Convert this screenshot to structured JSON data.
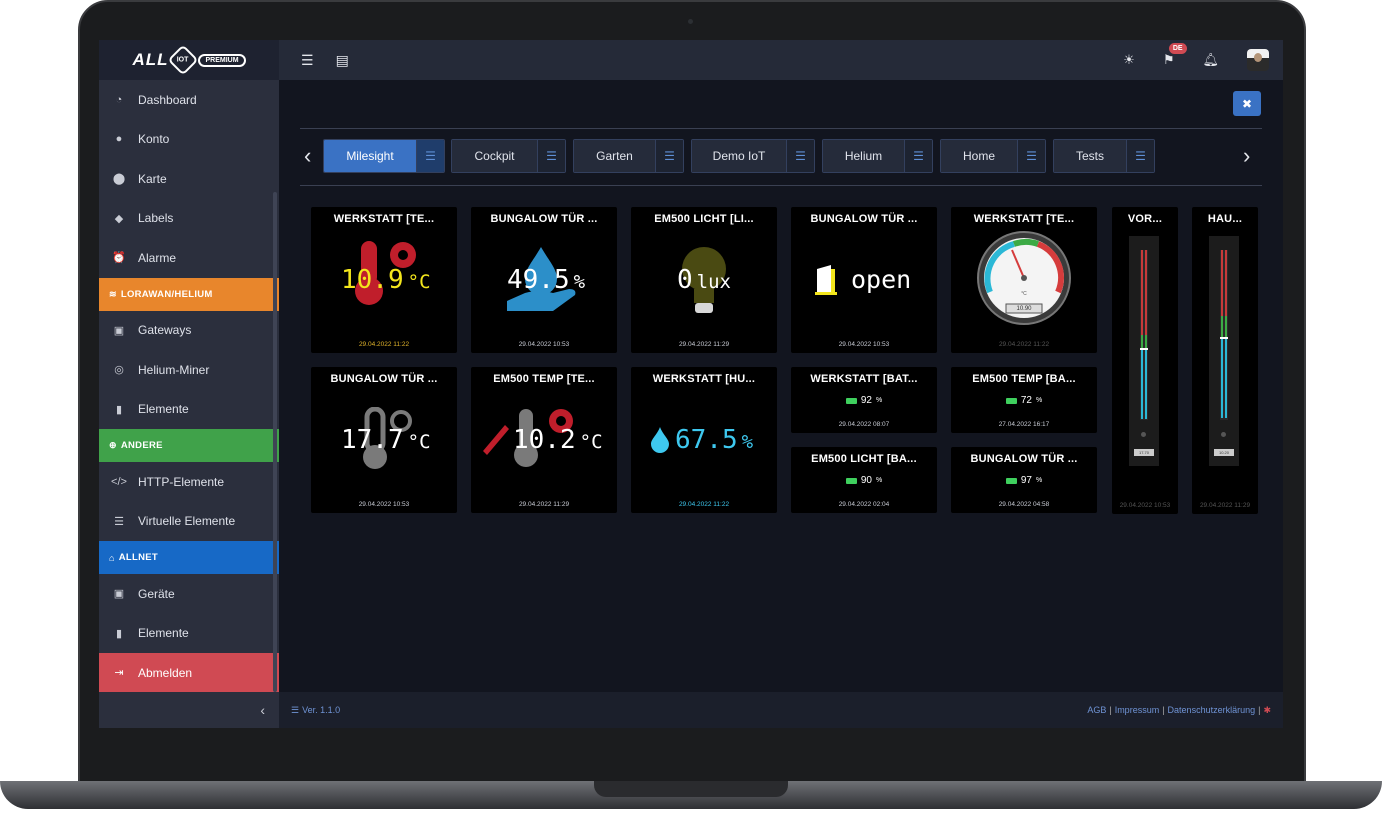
{
  "sidebar": {
    "items": [
      {
        "label": "Dashboard",
        "icon": "gauge-icon"
      },
      {
        "label": "Konto",
        "icon": "user-icon"
      },
      {
        "label": "Karte",
        "icon": "map-pin-icon"
      },
      {
        "label": "Labels",
        "icon": "tag-icon"
      },
      {
        "label": "Alarme",
        "icon": "alarm-clock-icon"
      }
    ],
    "section_lorawan": "LORAWAN/HELIUM",
    "lorawan_items": [
      {
        "label": "Gateways",
        "icon": "chip-icon"
      },
      {
        "label": "Helium-Miner",
        "icon": "miner-icon"
      },
      {
        "label": "Elemente",
        "icon": "thermometer-icon"
      }
    ],
    "section_andere": "ANDERE",
    "andere_items": [
      {
        "label": "HTTP-Elemente",
        "icon": "code-icon"
      },
      {
        "label": "Virtuelle Elemente",
        "icon": "database-icon"
      }
    ],
    "section_allnet": "ALLNET",
    "allnet_items": [
      {
        "label": "Geräte",
        "icon": "chip-icon"
      },
      {
        "label": "Elemente",
        "icon": "thermometer-icon"
      }
    ],
    "logout": "Abmelden"
  },
  "logo": {
    "all": "ALL",
    "iot": "IOT",
    "premium": "PREMIUM"
  },
  "topbar": {
    "language": "DE"
  },
  "tabs": [
    "Milesight",
    "Cockpit",
    "Garten",
    "Demo IoT",
    "Helium",
    "Home",
    "Tests"
  ],
  "tiles": {
    "t1": {
      "title": "WERKSTATT [TE...",
      "value": "10.9",
      "unit": "°C",
      "date": "29.04.2022 11:22",
      "value_color": "#f3e61c"
    },
    "t2": {
      "title": "BUNGALOW TÜR ...",
      "value": "49.5",
      "unit": "%",
      "date": "29.04.2022 10:53"
    },
    "t3": {
      "title": "EM500 LICHT [LI...",
      "value": "0",
      "unit": "lux",
      "date": "29.04.2022 11:29"
    },
    "t4": {
      "title": "BUNGALOW TÜR ...",
      "value": "open",
      "date": "29.04.2022 10:53"
    },
    "t5": {
      "title": "WERKSTATT [TE...",
      "gauge_label": "°C",
      "gauge_value": "10.90",
      "date": "29.04.2022 11:22"
    },
    "t6": {
      "title": "VOR...",
      "date": "29.04.2022 10:53",
      "bar_value": "17.70"
    },
    "t7": {
      "title": "HAU...",
      "date": "29.04.2022 11:29",
      "bar_value": "10.20"
    },
    "t8": {
      "title": "BUNGALOW TÜR ...",
      "value": "17.7",
      "unit": "°C",
      "date": "29.04.2022 10:53"
    },
    "t9": {
      "title": "EM500 TEMP [TE...",
      "value": "10.2",
      "unit": "°C",
      "date": "29.04.2022 11:29"
    },
    "t10": {
      "title": "WERKSTATT [HU...",
      "value": "67.5",
      "unit": "%",
      "date": "29.04.2022 11:22",
      "value_color": "#3ec8ef"
    },
    "t11": {
      "title": "WERKSTATT [BAT...",
      "value": "92",
      "unit": "%",
      "date": "29.04.2022 08:07"
    },
    "t12": {
      "title": "EM500 TEMP [BA...",
      "value": "72",
      "unit": "%",
      "date": "27.04.2022 16:17"
    },
    "t13": {
      "title": "EM500 LICHT [BA...",
      "value": "90",
      "unit": "%",
      "date": "29.04.2022 02:04"
    },
    "t14": {
      "title": "BUNGALOW TÜR ...",
      "value": "97",
      "unit": "%",
      "date": "29.04.2022 04:58"
    }
  },
  "footer": {
    "version": "Ver. 1.1.0",
    "agb": "AGB",
    "sep": "|",
    "impressum": "Impressum",
    "datenschutz": "Datenschutzerklärung"
  },
  "colors": {
    "accent": "#3a72c4",
    "orange": "#e8862c",
    "green": "#40a24a",
    "blue": "#1769c6",
    "red": "#d04a53"
  }
}
